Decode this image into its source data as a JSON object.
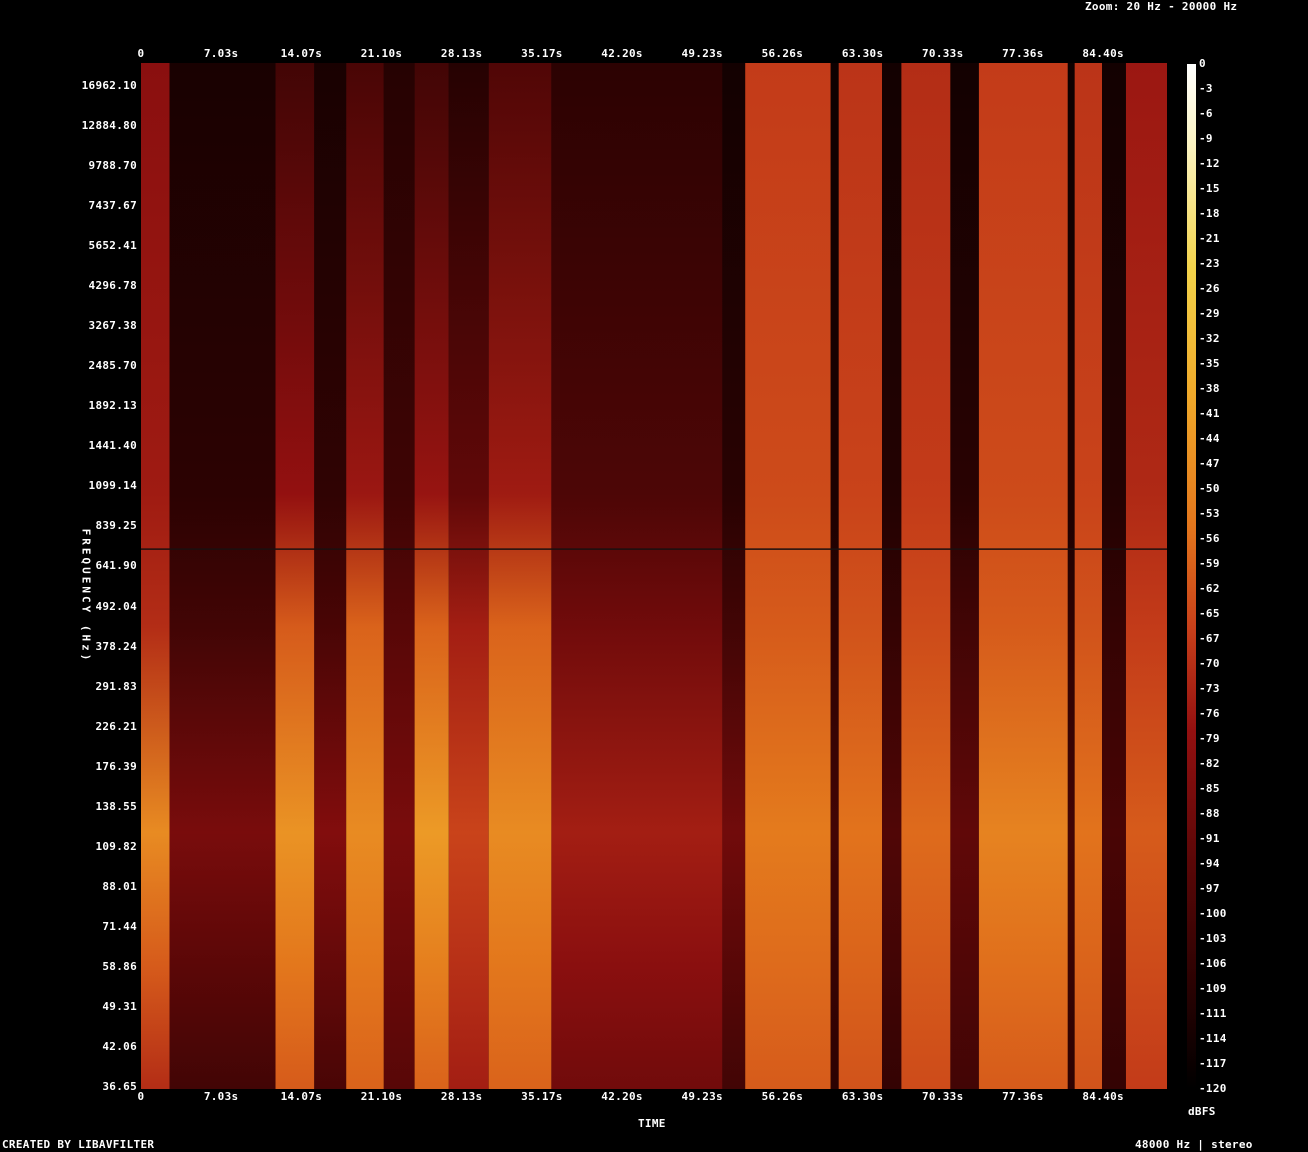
{
  "header": {
    "zoom": "Zoom: 20 Hz - 20000 Hz"
  },
  "footer": {
    "created_by": "CREATED BY LIBAVFILTER",
    "format": "48000 Hz | stereo"
  },
  "chart_data": {
    "type": "heatmap",
    "title": "",
    "xlabel": "TIME",
    "ylabel": "FREQUENCY (Hz)",
    "colorbar_unit": "dBFS",
    "x_ticks": [
      "0",
      "7.03s",
      "14.07s",
      "21.10s",
      "28.13s",
      "35.17s",
      "42.20s",
      "49.23s",
      "56.26s",
      "63.30s",
      "70.33s",
      "77.36s",
      "84.40s"
    ],
    "x_tick_values": [
      0,
      7.03,
      14.07,
      21.1,
      28.13,
      35.17,
      42.2,
      49.23,
      56.26,
      63.3,
      70.33,
      77.36,
      84.4
    ],
    "xlim": [
      0,
      90
    ],
    "y_ticks": [
      "16962.10",
      "12884.80",
      "9788.70",
      "7437.67",
      "5652.41",
      "4296.78",
      "3267.38",
      "2485.70",
      "1892.13",
      "1441.40",
      "1099.14",
      "839.25",
      "641.90",
      "492.04",
      "378.24",
      "291.83",
      "226.21",
      "176.39",
      "138.55",
      "109.82",
      "88.01",
      "71.44",
      "58.86",
      "49.31",
      "42.06",
      "36.65"
    ],
    "y_scale": "log",
    "ylim": [
      36.65,
      20000
    ],
    "colorbar_ticks": [
      "0",
      "-3",
      "-6",
      "-9",
      "-12",
      "-15",
      "-18",
      "-21",
      "-23",
      "-26",
      "-29",
      "-32",
      "-35",
      "-38",
      "-41",
      "-44",
      "-47",
      "-50",
      "-53",
      "-56",
      "-59",
      "-62",
      "-65",
      "-67",
      "-70",
      "-73",
      "-76",
      "-79",
      "-82",
      "-85",
      "-88",
      "-91",
      "-94",
      "-97",
      "-100",
      "-103",
      "-106",
      "-109",
      "-111",
      "-114",
      "-117",
      "-120"
    ],
    "colorbar_range": [
      -120,
      0
    ],
    "colormap": [
      "#000000",
      "#2a0202",
      "#5a0707",
      "#931010",
      "#c8401a",
      "#e3761c",
      "#f0aa2a",
      "#f3d34a",
      "#fbf3c0",
      "#ffffff"
    ],
    "segments": [
      {
        "t0": 0,
        "t1": 2.5,
        "low_db": -48,
        "mid_db": -72,
        "high_db": -82
      },
      {
        "t0": 2.5,
        "t1": 11.8,
        "low_db": -86,
        "mid_db": -100,
        "high_db": -112
      },
      {
        "t0": 11.8,
        "t1": 15.2,
        "low_db": -46,
        "mid_db": -60,
        "high_db": -100
      },
      {
        "t0": 15.2,
        "t1": 18.0,
        "low_db": -84,
        "mid_db": -98,
        "high_db": -112
      },
      {
        "t0": 18.0,
        "t1": 21.3,
        "low_db": -48,
        "mid_db": -58,
        "high_db": -98
      },
      {
        "t0": 21.3,
        "t1": 24.0,
        "low_db": -86,
        "mid_db": -94,
        "high_db": -108
      },
      {
        "t0": 24.0,
        "t1": 27.0,
        "low_db": -44,
        "mid_db": -58,
        "high_db": -100
      },
      {
        "t0": 27.0,
        "t1": 30.5,
        "low_db": -66,
        "mid_db": -76,
        "high_db": -108
      },
      {
        "t0": 30.5,
        "t1": 36.0,
        "low_db": -48,
        "mid_db": -58,
        "high_db": -96
      },
      {
        "t0": 36.0,
        "t1": 51.0,
        "low_db": -76,
        "mid_db": -88,
        "high_db": -106
      },
      {
        "t0": 51.0,
        "t1": 53.0,
        "low_db": -88,
        "mid_db": -100,
        "high_db": -114
      },
      {
        "t0": 53.0,
        "t1": 60.5,
        "low_db": -52,
        "mid_db": -60,
        "high_db": -68
      },
      {
        "t0": 60.5,
        "t1": 61.2,
        "low_db": -100,
        "mid_db": -106,
        "high_db": -116
      },
      {
        "t0": 61.2,
        "t1": 65.0,
        "low_db": -54,
        "mid_db": -62,
        "high_db": -70
      },
      {
        "t0": 65.0,
        "t1": 66.7,
        "low_db": -96,
        "mid_db": -104,
        "high_db": -114
      },
      {
        "t0": 66.7,
        "t1": 71.0,
        "low_db": -56,
        "mid_db": -64,
        "high_db": -72
      },
      {
        "t0": 71.0,
        "t1": 73.5,
        "low_db": -92,
        "mid_db": -100,
        "high_db": -114
      },
      {
        "t0": 73.5,
        "t1": 81.3,
        "low_db": -50,
        "mid_db": -60,
        "high_db": -68
      },
      {
        "t0": 81.3,
        "t1": 81.9,
        "low_db": -100,
        "mid_db": -106,
        "high_db": -116
      },
      {
        "t0": 81.9,
        "t1": 84.3,
        "low_db": -54,
        "mid_db": -62,
        "high_db": -70
      },
      {
        "t0": 84.3,
        "t1": 86.4,
        "low_db": -98,
        "mid_db": -104,
        "high_db": -114
      },
      {
        "t0": 86.4,
        "t1": 90,
        "low_db": -60,
        "mid_db": -68,
        "high_db": -78
      }
    ],
    "cursor_frequency_hz": 1010
  }
}
